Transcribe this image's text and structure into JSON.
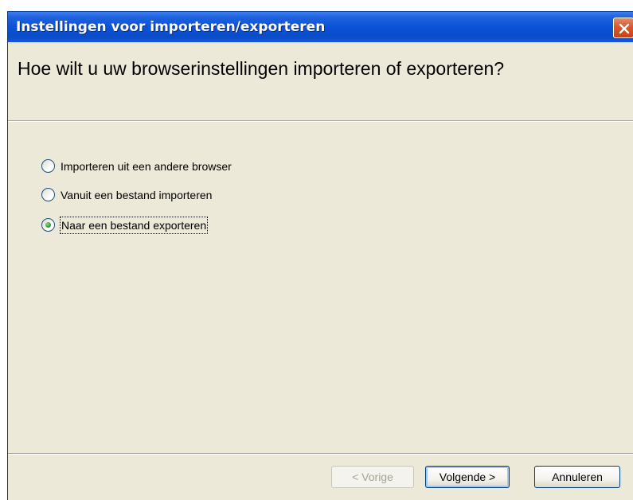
{
  "window": {
    "title": "Instellingen voor importeren/exporteren"
  },
  "header": {
    "question": "Hoe wilt u uw browserinstellingen importeren of exporteren?"
  },
  "options": [
    {
      "label": "Importeren uit een andere browser",
      "selected": false
    },
    {
      "label": "Vanuit een bestand importeren",
      "selected": false
    },
    {
      "label": "Naar een bestand exporteren",
      "selected": true
    }
  ],
  "buttons": {
    "back_label": "< Vorige",
    "back_enabled": false,
    "next_label": "Volgende >",
    "cancel_label": "Annuleren"
  },
  "colors": {
    "titlebar": "#0a52d8",
    "dialog_background": "#ece9d8",
    "close_button": "#d8592d",
    "radio_selected": "#39a03a"
  },
  "icons": {
    "close": "close-icon"
  }
}
